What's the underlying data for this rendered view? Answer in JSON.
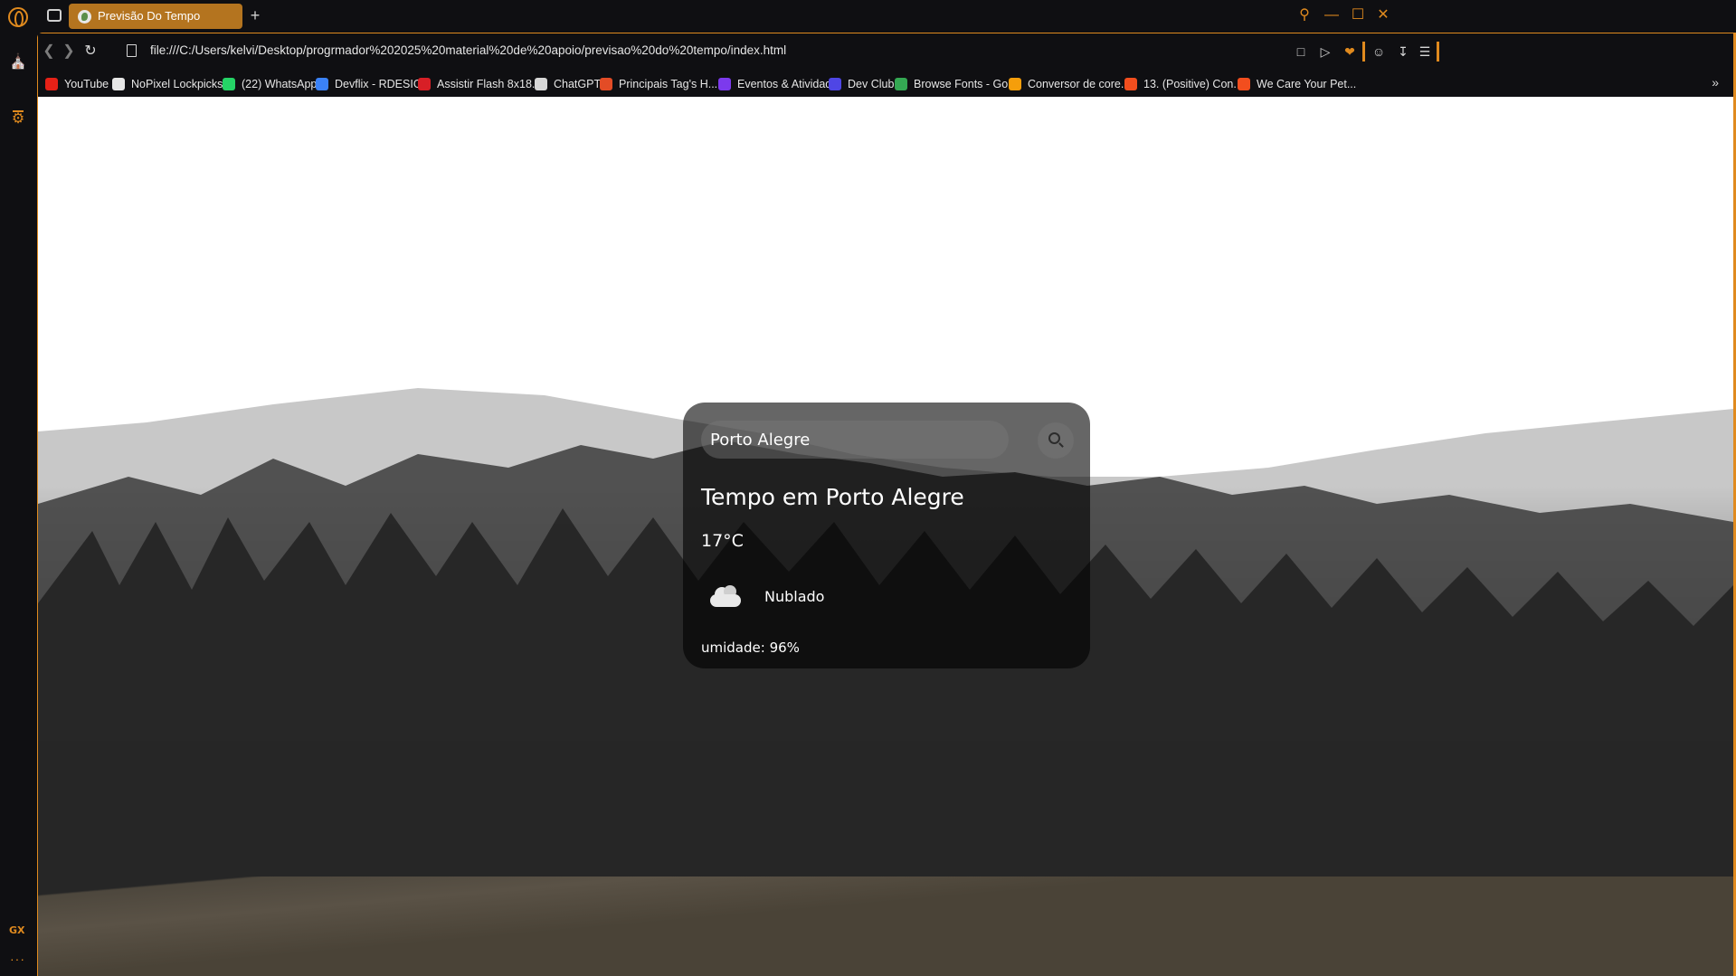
{
  "browser": {
    "tab_title": "Previsão Do Tempo",
    "new_tab_label": "+",
    "url": "file:///C:/Users/kelvi/Desktop/progrmador%202025%20material%20de%20apoio/previsao%20do%20tempo/index.html",
    "accent_color": "#e08a1e",
    "sidebar_badge": "GX",
    "sidebar_more": "···"
  },
  "bookmarks": [
    {
      "label": "YouTube",
      "color": "#e62117"
    },
    {
      "label": "NoPixel Lockpicks...",
      "color": "#e6e6e6"
    },
    {
      "label": "(22) WhatsApp",
      "color": "#25d366"
    },
    {
      "label": "Devflix - RDESIGN",
      "color": "#3b82f6"
    },
    {
      "label": "Assistir Flash 8x18...",
      "color": "#d81f26"
    },
    {
      "label": "ChatGPT",
      "color": "#d7d7d7"
    },
    {
      "label": "Principais Tag's H...",
      "color": "#e34c26"
    },
    {
      "label": "Eventos & Atividad...",
      "color": "#7c3aed"
    },
    {
      "label": "Dev Club",
      "color": "#4f46e5"
    },
    {
      "label": "Browse Fonts - Go...",
      "color": "#34a853"
    },
    {
      "label": "Conversor de core...",
      "color": "#f59e0b"
    },
    {
      "label": "13. (Positive) Con...",
      "color": "#f24e1e"
    },
    {
      "label": "We Care Your Pet...",
      "color": "#f24e1e"
    }
  ],
  "weather": {
    "search_value": "Porto Alegre",
    "city_title": "Tempo em Porto Alegre",
    "temperature": "17°C",
    "condition": "Nublado",
    "condition_icon": "cloud-icon",
    "humidity": "umidade: 96%"
  }
}
